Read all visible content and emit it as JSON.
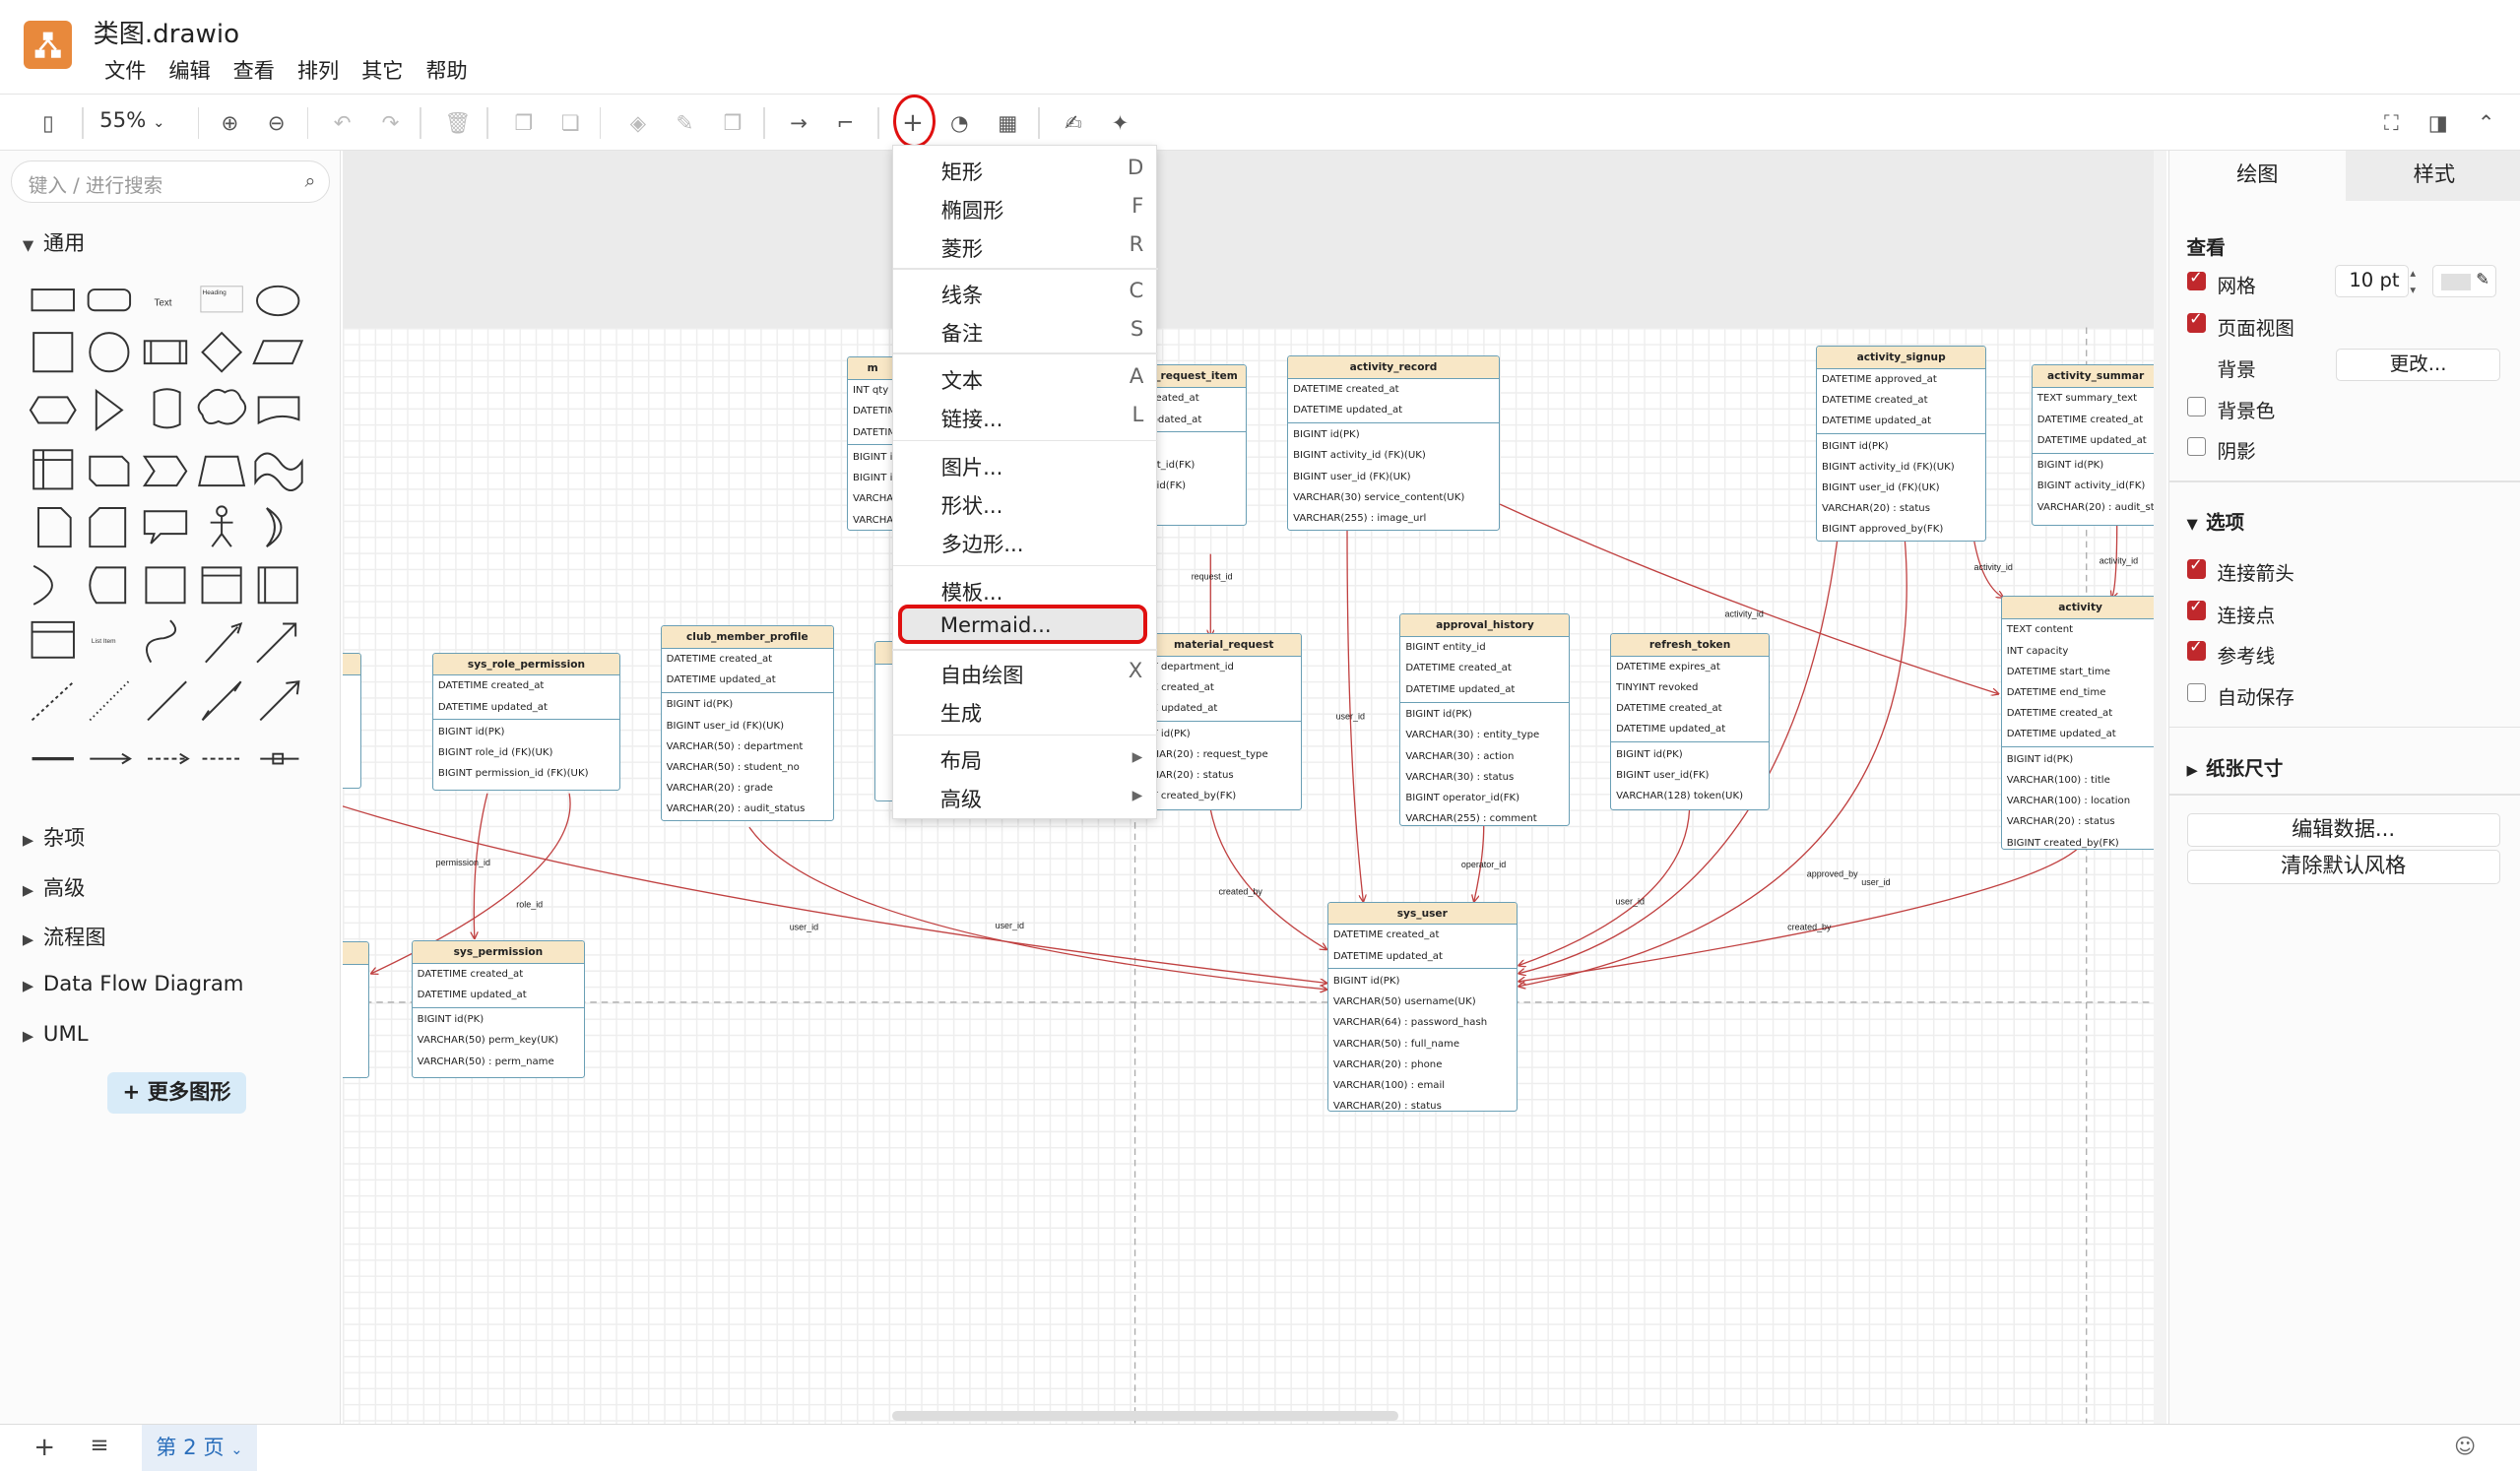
{
  "title": "类图.drawio",
  "menu": [
    "文件",
    "编辑",
    "查看",
    "排列",
    "其它",
    "帮助"
  ],
  "zoom": "55%",
  "search_placeholder": "键入 / 进行搜索",
  "left_sections": {
    "general": "通用",
    "misc": "杂项",
    "advanced": "高级",
    "flowchart": "流程图",
    "dfd": "Data Flow Diagram",
    "uml": "UML"
  },
  "more_shapes": "更多图形",
  "shape_text": "Text",
  "shape_heading": "Heading",
  "shape_listitem": "List Item",
  "insert_menu": {
    "items": [
      {
        "label": "矩形",
        "key": "D"
      },
      {
        "label": "椭圆形",
        "key": "F"
      },
      {
        "label": "菱形",
        "key": "R"
      },
      {
        "label": "线条",
        "key": "C"
      },
      {
        "label": "备注",
        "key": "S"
      },
      {
        "label": "文本",
        "key": "A"
      },
      {
        "label": "链接...",
        "key": "L"
      },
      {
        "label": "图片...",
        "key": ""
      },
      {
        "label": "形状...",
        "key": ""
      },
      {
        "label": "多边形...",
        "key": ""
      },
      {
        "label": "模板...",
        "key": ""
      },
      {
        "label": "Mermaid...",
        "key": ""
      },
      {
        "label": "自由绘图",
        "key": "X"
      },
      {
        "label": "生成",
        "key": ""
      },
      {
        "label": "布局",
        "key": "▸"
      },
      {
        "label": "高级",
        "key": "▸"
      }
    ]
  },
  "right": {
    "tab_draw": "绘图",
    "tab_style": "样式",
    "view": "查看",
    "grid": "网格",
    "grid_size": "10 pt",
    "page_view": "页面视图",
    "background": "背景",
    "change": "更改...",
    "bg_color": "背景色",
    "shadow": "阴影",
    "options": "选项",
    "conn_arrows": "连接箭头",
    "conn_points": "连接点",
    "guides": "参考线",
    "autosave": "自动保存",
    "paper_size": "纸张尺寸",
    "edit_data": "编辑数据...",
    "clear_style": "清除默认风格"
  },
  "page_tab": "第 2 页",
  "edge_labels": {
    "request_id": "request_id",
    "user_id": "user_id",
    "activity_id": "activity_id",
    "permission_id": "permission_id",
    "role_id": "role_id",
    "created_by": "created_by",
    "operator_id": "operator_id",
    "approved_by": "approved_by"
  },
  "entities": {
    "sys_role_permission": {
      "title": "sys_role_permission",
      "top": [
        "DATETIME created_at",
        "DATETIME updated_at"
      ],
      "bottom": [
        "BIGINT id(PK)",
        "BIGINT role_id (FK)(UK)",
        "BIGINT permission_id (FK)(UK)"
      ]
    },
    "club_member_profile": {
      "title": "club_member_profile",
      "top": [
        "DATETIME created_at",
        "DATETIME updated_at"
      ],
      "bottom": [
        "BIGINT id(PK)",
        "BIGINT user_id (FK)(UK)",
        "VARCHAR(50) : department",
        "VARCHAR(50) : student_no",
        "VARCHAR(20) : grade",
        "VARCHAR(20) : audit_status"
      ]
    },
    "sys_permission": {
      "title": "sys_permission",
      "top": [
        "DATETIME created_at",
        "DATETIME updated_at"
      ],
      "bottom": [
        "BIGINT id(PK)",
        "VARCHAR(50) perm_key(UK)",
        "VARCHAR(50) : perm_name"
      ]
    },
    "activity_record": {
      "title": "activity_record",
      "top": [
        "DATETIME created_at",
        "DATETIME updated_at"
      ],
      "bottom": [
        "BIGINT id(PK)",
        "BIGINT activity_id (FK)(UK)",
        "BIGINT user_id (FK)(UK)",
        "VARCHAR(30) service_content(UK)",
        "VARCHAR(255) : image_url"
      ]
    },
    "approval_history": {
      "title": "approval_history",
      "top": [
        "BIGINT entity_id",
        "DATETIME created_at",
        "DATETIME updated_at"
      ],
      "bottom": [
        "BIGINT id(PK)",
        "VARCHAR(30) : entity_type",
        "VARCHAR(30) : action",
        "VARCHAR(30) : status",
        "BIGINT operator_id(FK)",
        "VARCHAR(255) : comment"
      ]
    },
    "refresh_token": {
      "title": "refresh_token",
      "top": [
        "DATETIME expires_at",
        "TINYINT revoked",
        "DATETIME created_at",
        "DATETIME updated_at"
      ],
      "bottom": [
        "BIGINT id(PK)",
        "BIGINT user_id(FK)",
        "VARCHAR(128) token(UK)"
      ]
    },
    "activity_signup": {
      "title": "activity_signup",
      "top": [
        "DATETIME approved_at",
        "DATETIME created_at",
        "DATETIME updated_at"
      ],
      "bottom": [
        "BIGINT id(PK)",
        "BIGINT activity_id (FK)(UK)",
        "BIGINT user_id (FK)(UK)",
        "VARCHAR(20) : status",
        "BIGINT approved_by(FK)"
      ]
    },
    "activity_summary": {
      "title": "activity_summar",
      "top": [
        "TEXT summary_text",
        "DATETIME created_at",
        "DATETIME updated_at"
      ],
      "bottom": [
        "BIGINT id(PK)",
        "BIGINT activity_id(FK)",
        "VARCHAR(20) : audit_stat"
      ]
    },
    "activity": {
      "title": "activity",
      "top": [
        "TEXT content",
        "INT capacity",
        "DATETIME start_time",
        "DATETIME end_time",
        "DATETIME created_at",
        "DATETIME updated_at"
      ],
      "bottom": [
        "BIGINT id(PK)",
        "VARCHAR(100) : title",
        "VARCHAR(100) : location",
        "VARCHAR(20) : status",
        "BIGINT created_by(FK)"
      ]
    },
    "sys_user": {
      "title": "sys_user",
      "top": [
        "DATETIME created_at",
        "DATETIME updated_at"
      ],
      "bottom": [
        "BIGINT id(PK)",
        "VARCHAR(50) username(UK)",
        "VARCHAR(64) : password_hash",
        "VARCHAR(50) : full_name",
        "VARCHAR(20) : phone",
        "VARCHAR(100) : email",
        "VARCHAR(20) : status"
      ]
    },
    "material_request": {
      "title": "material_request",
      "top": [
        "T department_id",
        "E created_at",
        "E updated_at"
      ],
      "bottom": [
        "T id(PK)",
        "HAR(20) : request_type",
        "HAR(20) : status",
        "T created_by(FK)"
      ]
    },
    "request_item": {
      "title": "_request_item",
      "top": [
        "reated_at",
        "pdated_at"
      ],
      "bottom": [
        "",
        "st_id(FK)",
        "_id(FK)"
      ]
    },
    "partial_m": {
      "title": "m",
      "top": [
        "INT qty",
        "DATETIM",
        "DATETIM"
      ],
      "bottom": [
        "BIGINT id",
        "BIGINT id",
        "VARCHAR",
        "VARCHAR"
      ]
    }
  }
}
